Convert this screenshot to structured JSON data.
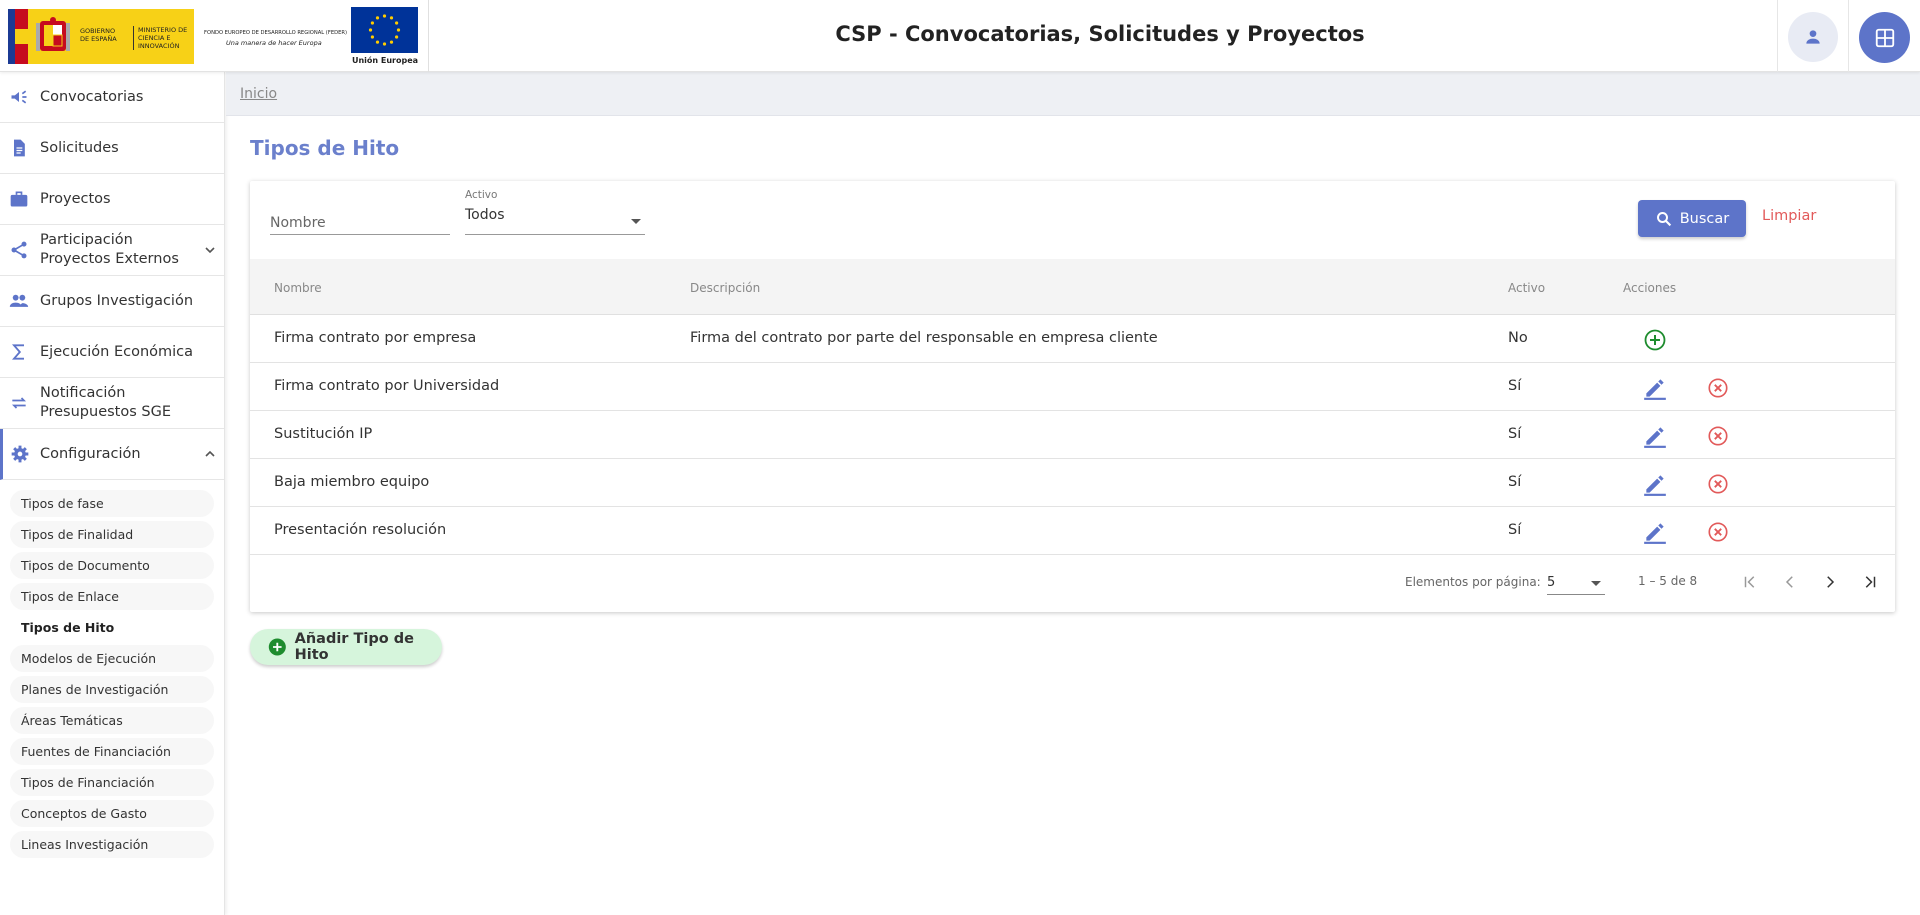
{
  "header": {
    "gob_text_1": "GOBIERNO DE ESPAÑA",
    "gob_text_2": "MINISTERIO DE CIENCIA E INNOVACIÓN",
    "feder_line_1": "FONDO EUROPEO DE DESARROLLO REGIONAL (FEDER)",
    "feder_line_2": "Una manera de hacer Europa",
    "eu_label": "Unión Europea",
    "title": "CSP - Convocatorias, Solicitudes y Proyectos",
    "user_icon": "person-icon",
    "apps_icon": "grid-icon"
  },
  "sidebar": {
    "items": [
      {
        "label": "Convocatorias",
        "icon": "megaphone-icon"
      },
      {
        "label": "Solicitudes",
        "icon": "document-icon"
      },
      {
        "label": "Proyectos",
        "icon": "briefcase-icon"
      },
      {
        "label": "Participación Proyectos Externos",
        "icon": "share-icon"
      },
      {
        "label": "Grupos Investigación",
        "icon": "people-icon"
      },
      {
        "label": "Ejecución Económica",
        "icon": "sigma-icon"
      },
      {
        "label": "Notificación Presupuestos SGE",
        "icon": "swap-icon"
      },
      {
        "label": "Configuración",
        "icon": "gear-icon"
      }
    ],
    "sub_items": [
      "Tipos de fase",
      "Tipos de Finalidad",
      "Tipos de Documento",
      "Tipos de Enlace",
      "Tipos de Hito",
      "Modelos de Ejecución",
      "Planes de Investigación",
      "Áreas Temáticas",
      "Fuentes de Financiación",
      "Tipos de Financiación",
      "Conceptos de Gasto",
      "Lineas Investigación"
    ],
    "selected_sub": "Tipos de Hito"
  },
  "breadcrumb": "Inicio",
  "page_title": "Tipos de Hito",
  "filters": {
    "nombre_placeholder": "Nombre",
    "activo_label": "Activo",
    "activo_value": "Todos",
    "buscar_label": "Buscar",
    "limpiar_label": "Limpiar"
  },
  "table": {
    "columns": [
      "Nombre",
      "Descripción",
      "Activo",
      "Acciones"
    ],
    "rows": [
      {
        "nombre": "Firma contrato por empresa",
        "descripcion": "Firma del contrato por parte del responsable en empresa cliente",
        "activo": "No"
      },
      {
        "nombre": "Firma contrato por Universidad",
        "descripcion": "",
        "activo": "Sí"
      },
      {
        "nombre": "Sustitución IP",
        "descripcion": "",
        "activo": "Sí"
      },
      {
        "nombre": "Baja miembro equipo",
        "descripcion": "",
        "activo": "Sí"
      },
      {
        "nombre": "Presentación resolución",
        "descripcion": "",
        "activo": "Sí"
      }
    ]
  },
  "paginator": {
    "items_per_page_label": "Elementos por página:",
    "page_size": "5",
    "range_label": "1 – 5 de 8"
  },
  "add_button_label": "Añadir Tipo de Hito",
  "colors": {
    "primary": "#5d74c9",
    "title": "#6b80cc",
    "danger": "#e25a5a",
    "success": "#1e8c2e",
    "add_bg": "#d6f5dc"
  }
}
